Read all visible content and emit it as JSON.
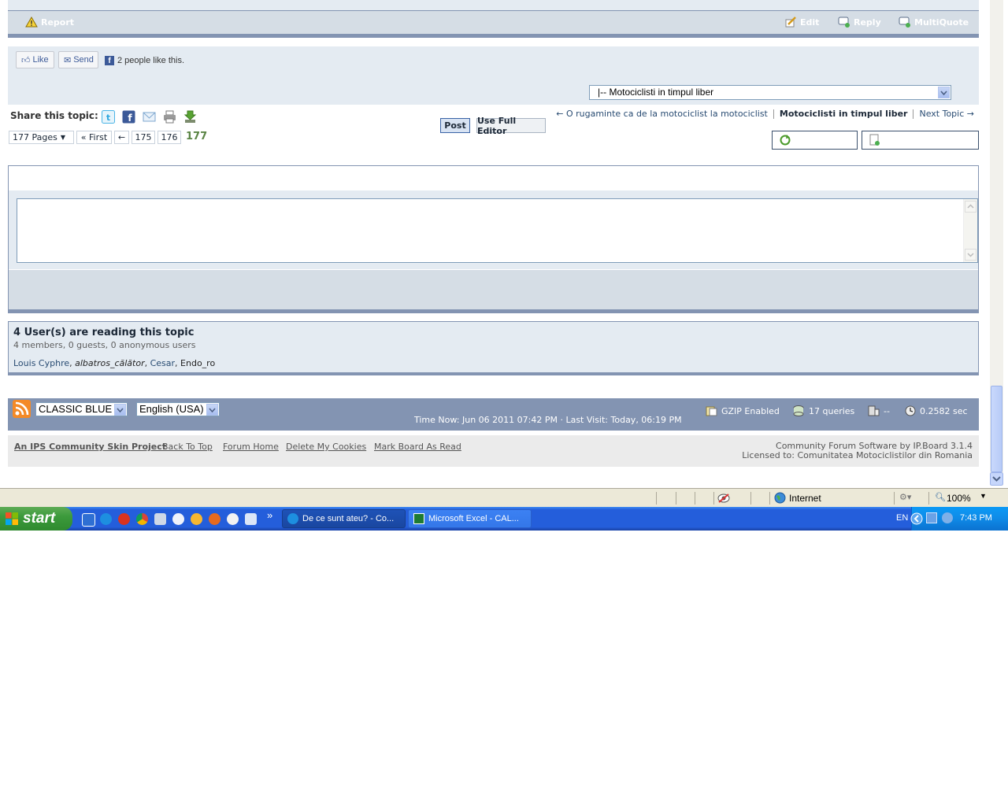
{
  "post_bar": {
    "report_label": "Report",
    "edit_label": "Edit",
    "reply_label": "Reply",
    "multiquote_label": "MultiQuote"
  },
  "social": {
    "like_label": "Like",
    "send_label": "Send",
    "likes_text": "2 people like this."
  },
  "forum_jump": {
    "selected": "|-- Motociclisti in timpul liber"
  },
  "share": {
    "label": "Share this topic:",
    "icons": [
      "twitter-icon",
      "facebook-icon",
      "email-icon",
      "print-icon",
      "download-icon"
    ]
  },
  "topic_nav": {
    "prev_label": "← O rugaminte ca de la motociclist la motociclist",
    "current_label": "Motociclisti in timpul liber",
    "next_label": "Next Topic →"
  },
  "pagination": {
    "pages_label": "177 Pages",
    "first_label": "« First",
    "prev_label": "←",
    "pages": [
      "175",
      "176"
    ],
    "current": "177"
  },
  "fast_reply": {
    "post_label": "Post",
    "full_editor_label": "Use Full Editor"
  },
  "readers": {
    "title": "4 User(s) are reading this topic",
    "summary": "4 members, 0 guests, 0 anonymous users",
    "users": [
      "Louis Cyphre",
      "albatros_călător",
      "Cesar",
      "Endo_ro"
    ]
  },
  "footer": {
    "skin": "CLASSIC BLUE",
    "language": "English (USA)",
    "time_text": "Time Now: Jun 06 2011 07:42 PM · Last Visit: Today, 06:19 PM",
    "gzip": "GZIP Enabled",
    "queries": "17 queries",
    "sql": "--",
    "exec_time": "0.2582 sec",
    "links": [
      "An IPS Community Skin Project",
      "Back To Top",
      "Forum Home",
      "Delete My Cookies",
      "Mark Board As Read"
    ],
    "copyright_1": "Community Forum Software by IP.Board 3.1.4",
    "copyright_2": "Licensed to: Comunitatea Motociclistilor din Romania"
  },
  "statusbar": {
    "zone": "Internet",
    "zoom": "100%"
  },
  "taskbar": {
    "start_label": "start",
    "more": "»",
    "tasks": [
      "De ce sunt ateu? - Co...",
      "Microsoft Excel - CAL..."
    ],
    "lang": "EN",
    "clock": "7:43 PM"
  },
  "colors": {
    "forum_accent": "#8394b2",
    "panel_bg": "#e4ebf2",
    "link": "#284b72",
    "current_page": "#5a8444",
    "taskbar_blue": "#245edb",
    "start_green": "#3c9a3c"
  }
}
